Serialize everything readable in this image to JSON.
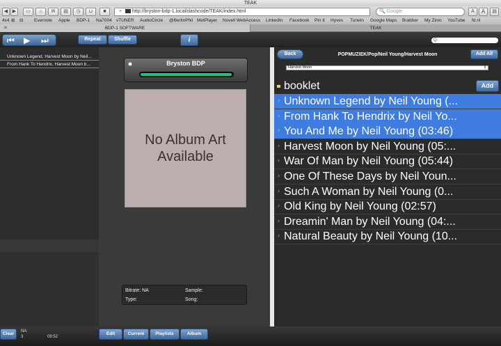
{
  "window": {
    "title": "TEAK"
  },
  "toolbar": {
    "url": "http://bryston-bdp-1.local/dashcode/TEAK/index.html",
    "search_placeholder": "Google",
    "text_smaller": "A",
    "text_larger": "A"
  },
  "bookmarks": [
    "4x4",
    "Evernote",
    "Apple",
    "BDP-1",
    "Na7004",
    "vTUNER",
    "AudioCircle",
    "@BerlinPhil",
    "MetPlayer",
    "Novell WebAccess",
    "LinkedIn",
    "Facebook",
    "Pin It",
    "Hyves",
    "TuneIn",
    "Google Maps",
    "Brabber",
    "My Zinio",
    "YouTube",
    "fd.nl"
  ],
  "tabs": [
    {
      "label": "BDP-1 SOFTWARE"
    },
    {
      "label": "TEAK"
    }
  ],
  "app_header": {
    "repeat_label": "Repeat",
    "shuffle_label": "Shuffle",
    "info_label": "i",
    "search_value": "Q-"
  },
  "queue": [
    "Unknown Legend, Harvest Moon by Neil...",
    "From Hank To Hendrix, Harvest Moon b..."
  ],
  "player": {
    "name": "Bryston BDP",
    "progress": 0.99,
    "album_art_text": "No Album Art\nAvailable",
    "bitrate_label": "Bitrate: NA",
    "sample_label": "Sample:",
    "type_label": "Type:",
    "song_label": "Song:"
  },
  "browser": {
    "back_label": "Back",
    "breadcrumb": "POPMUZIEK/Pop/Neil Young/Harvest Moon",
    "add_all_label": "Add All",
    "select_value": "Harvest Moon",
    "booklet_label": "booklet",
    "add_label": "Add",
    "songs": [
      {
        "title": "Unknown Legend by Neil Young (...",
        "selected": true
      },
      {
        "title": "From Hank To Hendrix by Neil Yo...",
        "selected": true
      },
      {
        "title": "You And Me by Neil Young (03:46)",
        "selected": true
      },
      {
        "title": "Harvest Moon by Neil Young (05:...",
        "selected": false
      },
      {
        "title": "War Of Man by Neil Young (05:44)",
        "selected": false
      },
      {
        "title": "One Of These Days by Neil Youn...",
        "selected": false
      },
      {
        "title": "Such A Woman by Neil Young (0...",
        "selected": false
      },
      {
        "title": "Old King by Neil Young (02:57)",
        "selected": false
      },
      {
        "title": "Dreamin' Man by Neil Young (04:...",
        "selected": false
      },
      {
        "title": "Natural Beauty by Neil Young (10...",
        "selected": false
      }
    ]
  },
  "bottom": {
    "clear_label": "Clear",
    "na_text": "NA",
    "count_text": "3",
    "time_text": "09:52",
    "edit_label": "Edit",
    "current_label": "Current",
    "playlists_label": "Playlists",
    "album_label": "Album"
  },
  "colors": {
    "accent_blue": "#3e7ce0",
    "progress_green": "#14c38e",
    "album_art_bg": "#bcaeae"
  }
}
